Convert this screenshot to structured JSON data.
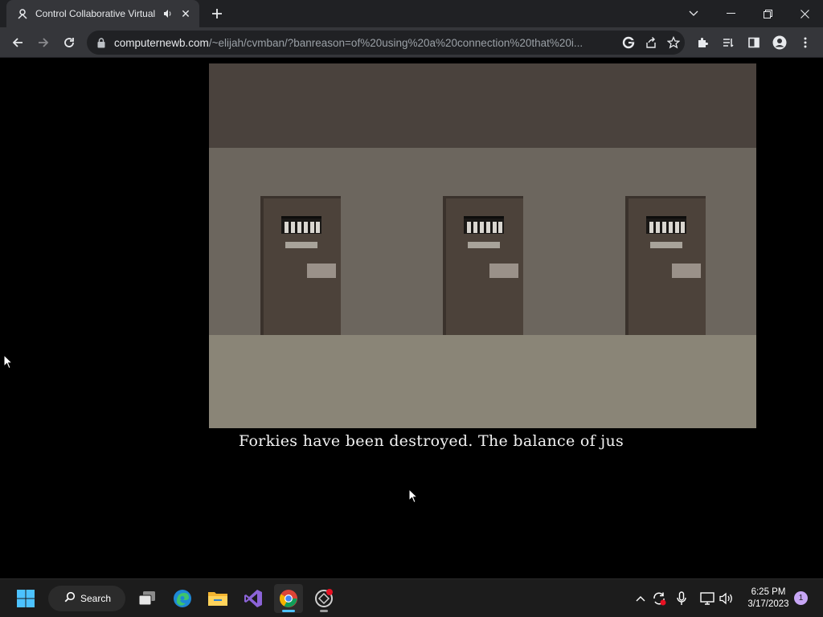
{
  "browser": {
    "tab": {
      "title": "Control Collaborative Virtual",
      "favicon": "cvm-logo-icon",
      "audio_icon": "speaker-icon"
    },
    "address_bar": {
      "host": "computernewb.com",
      "path": "/~elijah/cvmban/?banreason=of%20using%20a%20connection%20that%20i..."
    },
    "icons": [
      "back-icon",
      "forward-icon",
      "reload-icon",
      "lock-icon",
      "google-icon",
      "share-icon",
      "bookmark-star-icon",
      "extensions-icon",
      "reading-list-icon",
      "side-panel-icon",
      "profile-icon",
      "menu-icon"
    ]
  },
  "vm": {
    "scene": "prison-cell-corridor",
    "door_count": 3,
    "subtitle": "Forkies have been destroyed. The balance of jus",
    "colors": {
      "ceiling": "#4a423d",
      "wall": "#6c665e",
      "floor": "#8a8577",
      "door": "#4c423a"
    }
  },
  "taskbar": {
    "search_label": "Search",
    "apps": [
      "start-icon",
      "search-icon",
      "task-view-icon",
      "edge-icon",
      "file-explorer-icon",
      "visual-studio-icon",
      "chrome-icon",
      "app-icon"
    ],
    "active_app": "chrome-icon",
    "clock": {
      "time": "6:25 PM",
      "date": "3/17/2023"
    },
    "notification_count": "1"
  }
}
